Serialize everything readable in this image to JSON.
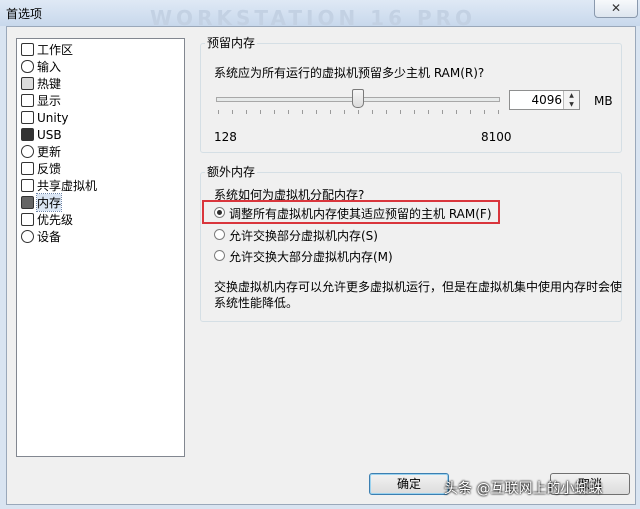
{
  "window": {
    "title": "首选项",
    "watermark_text": "WORKSTATION 16 PRO",
    "close_label": "✕"
  },
  "sidebar": {
    "items": [
      {
        "label": "工作区",
        "icon": "workspace-icon"
      },
      {
        "label": "输入",
        "icon": "mouse-icon"
      },
      {
        "label": "热键",
        "icon": "keyboard-icon"
      },
      {
        "label": "显示",
        "icon": "monitor-icon"
      },
      {
        "label": "Unity",
        "icon": "unity-icon"
      },
      {
        "label": "USB",
        "icon": "usb-icon"
      },
      {
        "label": "更新",
        "icon": "refresh-icon"
      },
      {
        "label": "反馈",
        "icon": "feedback-icon"
      },
      {
        "label": "共享虚拟机",
        "icon": "share-icon"
      },
      {
        "label": "内存",
        "icon": "memory-icon",
        "selected": true
      },
      {
        "label": "优先级",
        "icon": "priority-icon"
      },
      {
        "label": "设备",
        "icon": "gear-icon"
      }
    ]
  },
  "reserved_memory": {
    "group_title": "预留内存",
    "question": "系统应为所有运行的虚拟机预留多少主机 RAM(R)?",
    "slider_min_label": "128",
    "slider_max_label": "8100",
    "slider_min": 128,
    "slider_max": 8100,
    "value": "4096",
    "unit": "MB"
  },
  "extra_memory": {
    "group_title": "额外内存",
    "question": "系统如何为虚拟机分配内存?",
    "options": [
      {
        "label": "调整所有虚拟机内存使其适应预留的主机 RAM(F)",
        "selected": true
      },
      {
        "label": "允许交换部分虚拟机内存(S)",
        "selected": false
      },
      {
        "label": "允许交换大部分虚拟机内存(M)",
        "selected": false
      }
    ],
    "note_line1": "交换虚拟机内存可以允许更多虚拟机运行，但是在虚拟机集中使用内存时会使",
    "note_line2": "系统性能降低。"
  },
  "buttons": {
    "ok": "确定",
    "cancel": "取消"
  },
  "overlay_watermark": "头条 @互联网上的小蜘蛛",
  "colors": {
    "highlight_box": "#d9353c",
    "selection": "#dbe6f4"
  }
}
